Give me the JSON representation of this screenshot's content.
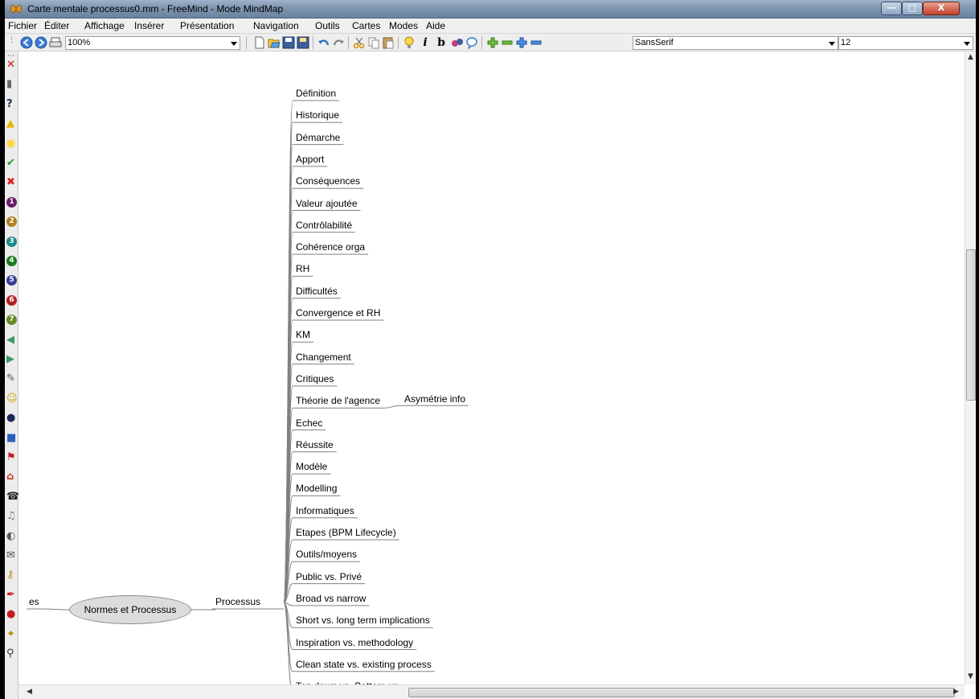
{
  "window": {
    "title": "Carte mentale processus0.mm - FreeMind - Mode MindMap",
    "min_label": "—",
    "max_label": "□",
    "close_label": "X"
  },
  "menu": [
    "Fichier",
    "Éditer",
    "Affichage",
    "Insérer",
    "Présentation",
    "Navigation",
    "Outils",
    "Cartes",
    "Modes",
    "Aide"
  ],
  "toolbar": {
    "zoom": "100%",
    "font_family": "SansSerif",
    "font_size": "12",
    "italic_label": "i",
    "bold_label": "b"
  },
  "left_icons": [
    "delete-icon",
    "trash-icon",
    "question-icon",
    "warning-icon",
    "idea-icon",
    "check-icon",
    "cross-icon",
    "priority-1-icon",
    "priority-2-icon",
    "priority-3-icon",
    "priority-4-icon",
    "priority-5-icon",
    "priority-6-icon",
    "priority-7-icon",
    "arrow-left-icon",
    "arrow-right-icon",
    "pencil-icon",
    "smiley-icon",
    "bomb-icon",
    "book-icon",
    "flag-icon",
    "home-icon",
    "phone-icon",
    "music-icon",
    "glasses-icon",
    "mail-icon",
    "key-icon",
    "pen-icon",
    "stop-light-icon",
    "magic-wand-icon",
    "zoom-icon"
  ],
  "colors": {
    "title_bar": "#7f96b0",
    "root_fill": "#dcdcdc",
    "edge": "#808080",
    "close_button": "#c4402a"
  },
  "mindmap": {
    "root": "Normes et Processus",
    "left_partial": "es",
    "branch": "Processus",
    "children": [
      "Définition",
      "Historique",
      "Démarche",
      "Apport",
      "Conséquences",
      "Valeur ajoutée",
      "Contrôlabilité",
      "Cohérence orga",
      "RH",
      "Difficultés",
      "Convergence et RH",
      "KM",
      "Changement",
      "Critiques",
      "Théorie de l'agence",
      "Echec",
      "Réussite",
      "Modèle",
      "Modelling",
      "Informatiques",
      "Etapes (BPM Lifecycle)",
      "Outils/moyens",
      "Public vs. Privé",
      "Broad vs narrow",
      "Short vs. long term implications",
      "Inspiration vs. methodology",
      "Clean state vs. existing process",
      "Top down vs. Bottom up"
    ],
    "grandchild": {
      "parent_index": 14,
      "label": "Asymétrie info"
    }
  }
}
